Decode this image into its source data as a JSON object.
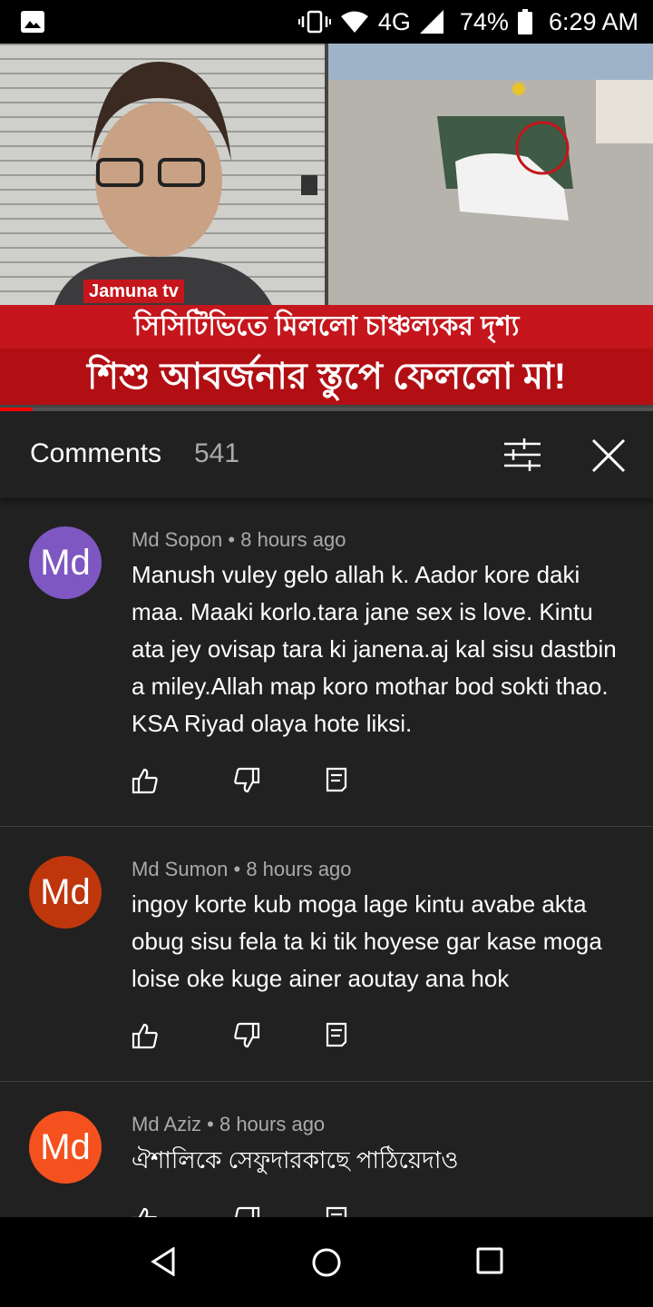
{
  "status_bar": {
    "network": "4G",
    "battery": "74%",
    "time": "6:29 AM",
    "icons": [
      "image-icon",
      "vibrate-icon",
      "wifi-icon",
      "signal-icon",
      "battery-icon"
    ]
  },
  "video": {
    "channel_logo": "Jamuna tv",
    "headline_line1": "সিসিটিভিতে মিললো চাঞ্চল্যকর দৃশ্য",
    "headline_line2": "শিশু আবর্জনার স্তুপে ফেললো মা!",
    "progress": 0.05,
    "accent_color": "#c4161c"
  },
  "comments_header": {
    "title": "Comments",
    "count": "541",
    "icons": [
      "filter-icon",
      "close-icon"
    ]
  },
  "comments": [
    {
      "avatar_text": "Md",
      "avatar_color": "#7e57c2",
      "author": "Md Sopon",
      "time": "8 hours ago",
      "text": "Manush vuley gelo allah k. Aador kore daki maa. Maaki korlo.tara jane sex is love. Kintu ata jey ovisap tara ki janena.aj kal sisu dastbin a miley.Allah  map koro mothar bod sokti thao. KSA Riyad olaya hote liksi."
    },
    {
      "avatar_text": "Md",
      "avatar_color": "#bf360c",
      "author": "Md Sumon",
      "time": "8 hours ago",
      "text": "ingoy korte kub moga lage kintu avabe akta obug sisu fela ta ki tik hoyese gar kase moga loise oke kuge ainer aoutay ana hok"
    },
    {
      "avatar_text": "Md",
      "avatar_color": "#f4511e",
      "author": "Md Aziz",
      "time": "8 hours ago",
      "text": "ঐশালিকে সেফুদারকাছে পাঠিয়েদাও"
    }
  ],
  "nav_bar": {
    "icons": [
      "back-icon",
      "home-icon",
      "recents-icon"
    ]
  }
}
